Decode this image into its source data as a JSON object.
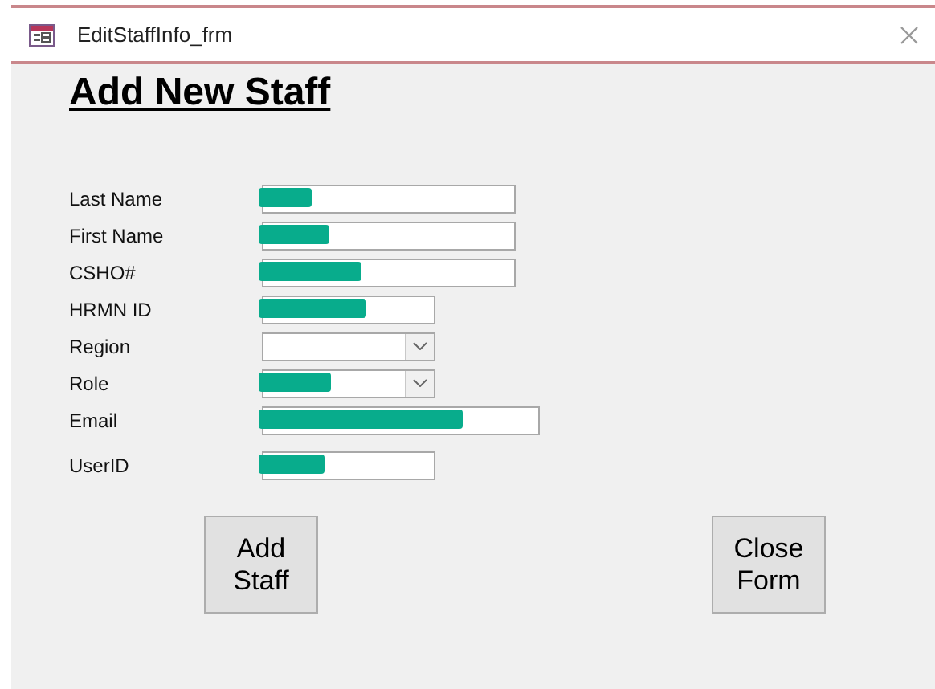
{
  "window": {
    "title": "EditStaffInfo_frm"
  },
  "heading": "Add New Staff",
  "fields": [
    {
      "label": "Last Name",
      "kind": "text",
      "redacted": true
    },
    {
      "label": "First Name",
      "kind": "text",
      "redacted": true
    },
    {
      "label": "CSHO#",
      "kind": "text",
      "redacted": true
    },
    {
      "label": "HRMN ID",
      "kind": "text",
      "redacted": true
    },
    {
      "label": "Region",
      "kind": "combo",
      "redacted": false
    },
    {
      "label": "Role",
      "kind": "combo",
      "redacted": true
    },
    {
      "label": "Email",
      "kind": "text",
      "redacted": true
    },
    {
      "label": "UserID",
      "kind": "text",
      "redacted": true
    }
  ],
  "buttons": [
    {
      "label": "Add\nStaff"
    },
    {
      "label": "Close\nForm"
    }
  ]
}
